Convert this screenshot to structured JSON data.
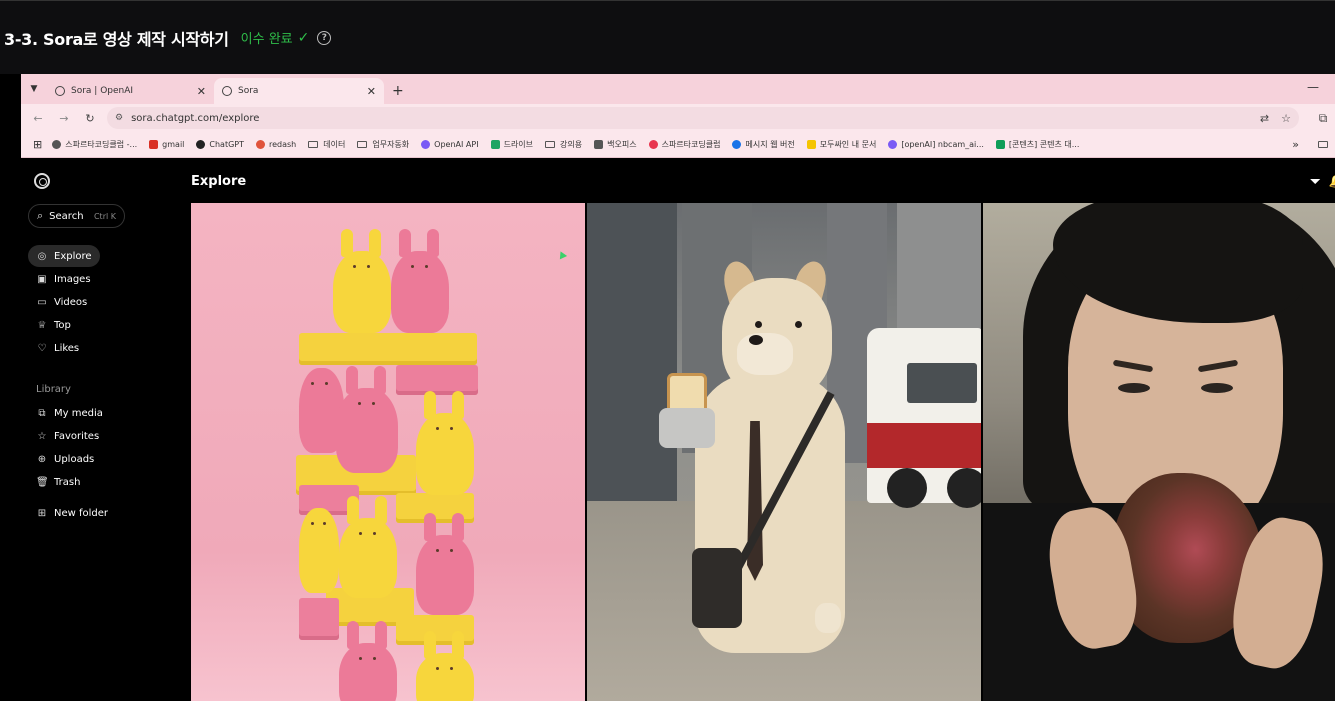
{
  "lesson": {
    "title": "3-3. Sora로 영상 제작 시작하기",
    "status": "이수 완료",
    "check_glyph": "✓",
    "help_glyph": "?"
  },
  "browser": {
    "tabs": [
      {
        "label": "Sora | OpenAI",
        "active": false
      },
      {
        "label": "Sora",
        "active": true
      }
    ],
    "new_tab_glyph": "+",
    "url": "sora.chatgpt.com/explore",
    "bookmarks": [
      {
        "label": "스파르타코딩클럽 -...",
        "icon_color": "#555555"
      },
      {
        "label": "gmail",
        "icon_color": "#d93025"
      },
      {
        "label": "ChatGPT",
        "icon_color": "#222222"
      },
      {
        "label": "redash",
        "icon_color": "#e0533b"
      },
      {
        "label": "데이터",
        "icon": "folder"
      },
      {
        "label": "업무자동화",
        "icon": "folder"
      },
      {
        "label": "OpenAI API",
        "icon_color": "#7a5af5"
      },
      {
        "label": "드라이브",
        "icon_color": "#1fa463"
      },
      {
        "label": "강의용",
        "icon": "folder"
      },
      {
        "label": "백오피스",
        "icon_color": "#555555"
      },
      {
        "label": "스파르타코딩클럽",
        "icon_color": "#e8344e"
      },
      {
        "label": "메시지 웹 버전",
        "icon_color": "#1a73e8"
      },
      {
        "label": "모두싸인 내 문서",
        "icon_color": "#f5c400"
      },
      {
        "label": "[openAI] nbcam_ai...",
        "icon_color": "#7a5af5"
      },
      {
        "label": "[콘텐츠] 콘텐츠 대...",
        "icon_color": "#0f9d58"
      }
    ],
    "more_glyph": "»"
  },
  "sora": {
    "search": {
      "label": "Search",
      "shortcut": "Ctrl K"
    },
    "nav": [
      {
        "label": "Explore",
        "icon": "compass-icon",
        "glyph": "◎",
        "active": true
      },
      {
        "label": "Images",
        "icon": "image-icon",
        "glyph": "▣",
        "active": false
      },
      {
        "label": "Videos",
        "icon": "video-icon",
        "glyph": "▭",
        "active": false
      },
      {
        "label": "Top",
        "icon": "trophy-icon",
        "glyph": "♕",
        "active": false
      },
      {
        "label": "Likes",
        "icon": "heart-icon",
        "glyph": "♡",
        "active": false
      }
    ],
    "library_label": "Library",
    "library": [
      {
        "label": "My media",
        "icon": "media-icon",
        "glyph": "⧉"
      },
      {
        "label": "Favorites",
        "icon": "star-icon",
        "glyph": "☆"
      },
      {
        "label": "Uploads",
        "icon": "upload-icon",
        "glyph": "⊕"
      },
      {
        "label": "Trash",
        "icon": "trash-icon",
        "glyph": "🗑"
      }
    ],
    "new_folder": {
      "label": "New folder",
      "icon": "folder-plus-icon",
      "glyph": "⊞"
    },
    "page_title": "Explore",
    "tiles": [
      {
        "subject": "peeps-tower"
      },
      {
        "subject": "dog-in-suit"
      },
      {
        "subject": "woman-eating-steak"
      }
    ]
  }
}
